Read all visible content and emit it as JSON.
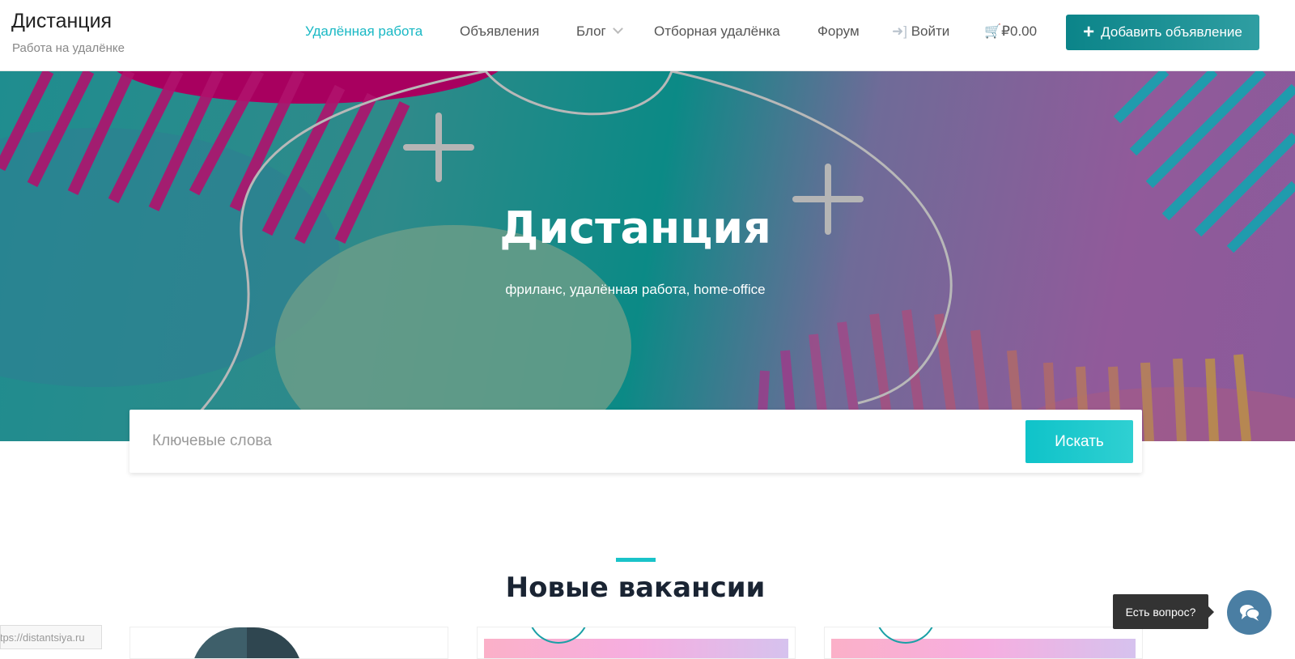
{
  "header": {
    "logo": "Дистанция",
    "tagline": "Работа на удалёнке",
    "nav": [
      {
        "label": "Удалённая работа"
      },
      {
        "label": "Объявления"
      },
      {
        "label": "Блог"
      },
      {
        "label": "Отборная удалёнка"
      },
      {
        "label": "Форум"
      },
      {
        "label": "Войти"
      },
      {
        "label": "₽0.00"
      }
    ],
    "add_button": "Добавить объявление"
  },
  "hero": {
    "title": "Дистанция",
    "subtitle": "фриланс, удалённая работа, home-office"
  },
  "search": {
    "placeholder": "Ключевые слова",
    "button": "Искать"
  },
  "section": {
    "title": "Новые вакансии"
  },
  "status_url": "https://distantsiya.ru",
  "chat": {
    "tooltip": "Есть вопрос?"
  },
  "colors": {
    "accent": "#19b8c4",
    "primary": "#0b8489",
    "chat": "#4a7ea3"
  }
}
